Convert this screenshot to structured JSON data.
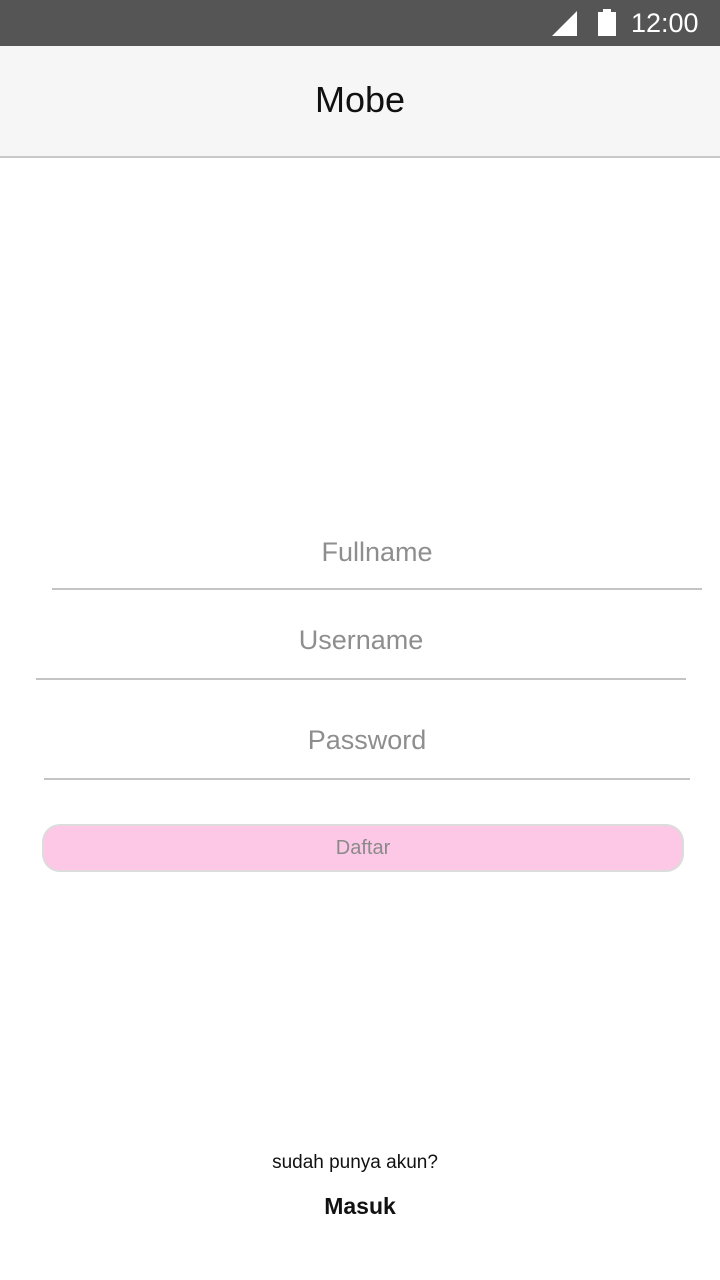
{
  "status_bar": {
    "time": "12:00",
    "icons": [
      "signal-icon",
      "battery-icon"
    ]
  },
  "app_bar": {
    "title": "Mobe"
  },
  "form": {
    "fullname_placeholder": "Fullname",
    "fullname_value": "",
    "username_placeholder": "Username",
    "username_value": "",
    "password_placeholder": "Password",
    "password_value": "",
    "register_label": "Daftar"
  },
  "footer": {
    "prompt": "sudah punya akun?",
    "login_label": "Masuk"
  },
  "colors": {
    "status_bar_bg": "#555555",
    "app_bar_bg": "#f6f6f6",
    "button_bg": "#fdc8e6",
    "button_text": "#8a8a8a",
    "placeholder": "#8e8e8e"
  }
}
